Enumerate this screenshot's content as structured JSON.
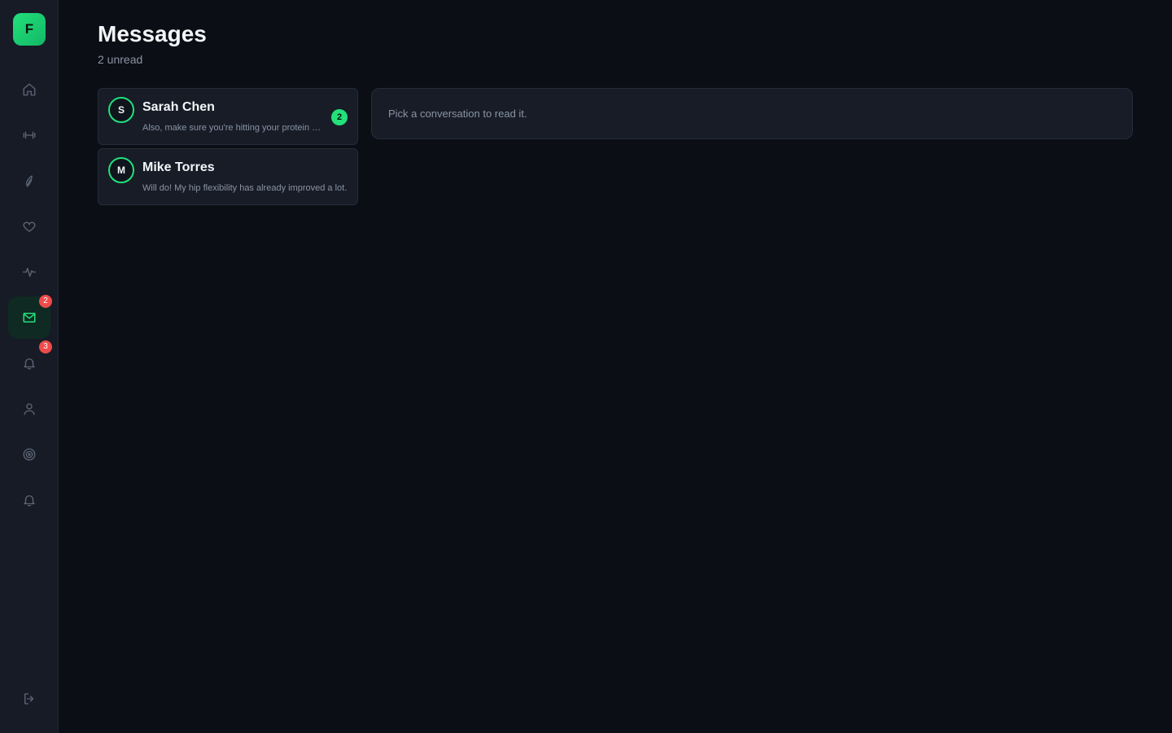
{
  "app": {
    "logo_letter": "F",
    "accent": "#22e07a",
    "badge_color": "#f04b4b"
  },
  "sidebar": {
    "items": [
      {
        "name": "home",
        "icon": "home-icon"
      },
      {
        "name": "workouts",
        "icon": "dumbbell-icon"
      },
      {
        "name": "nutrition",
        "icon": "leaf-icon"
      },
      {
        "name": "health",
        "icon": "heart-icon"
      },
      {
        "name": "activity",
        "icon": "activity-icon"
      },
      {
        "name": "messages",
        "icon": "mail-icon",
        "badge": "2",
        "active": true
      },
      {
        "name": "notifications",
        "icon": "bell-icon",
        "badge": "3"
      },
      {
        "name": "profile",
        "icon": "user-icon"
      },
      {
        "name": "goals",
        "icon": "target-icon"
      },
      {
        "name": "reminders",
        "icon": "bell-icon"
      }
    ],
    "logout_icon": "logout-icon"
  },
  "page": {
    "title": "Messages",
    "subtitle": "2 unread"
  },
  "conversations": [
    {
      "initial": "S",
      "name": "Sarah Chen",
      "preview": "Also, make sure you're hitting your protein goals this week.",
      "unread": "2"
    },
    {
      "initial": "M",
      "name": "Mike Torres",
      "preview": "Will do! My hip flexibility has already improved a lot.",
      "unread": null
    }
  ],
  "reader": {
    "empty_text": "Pick a conversation to read it."
  }
}
